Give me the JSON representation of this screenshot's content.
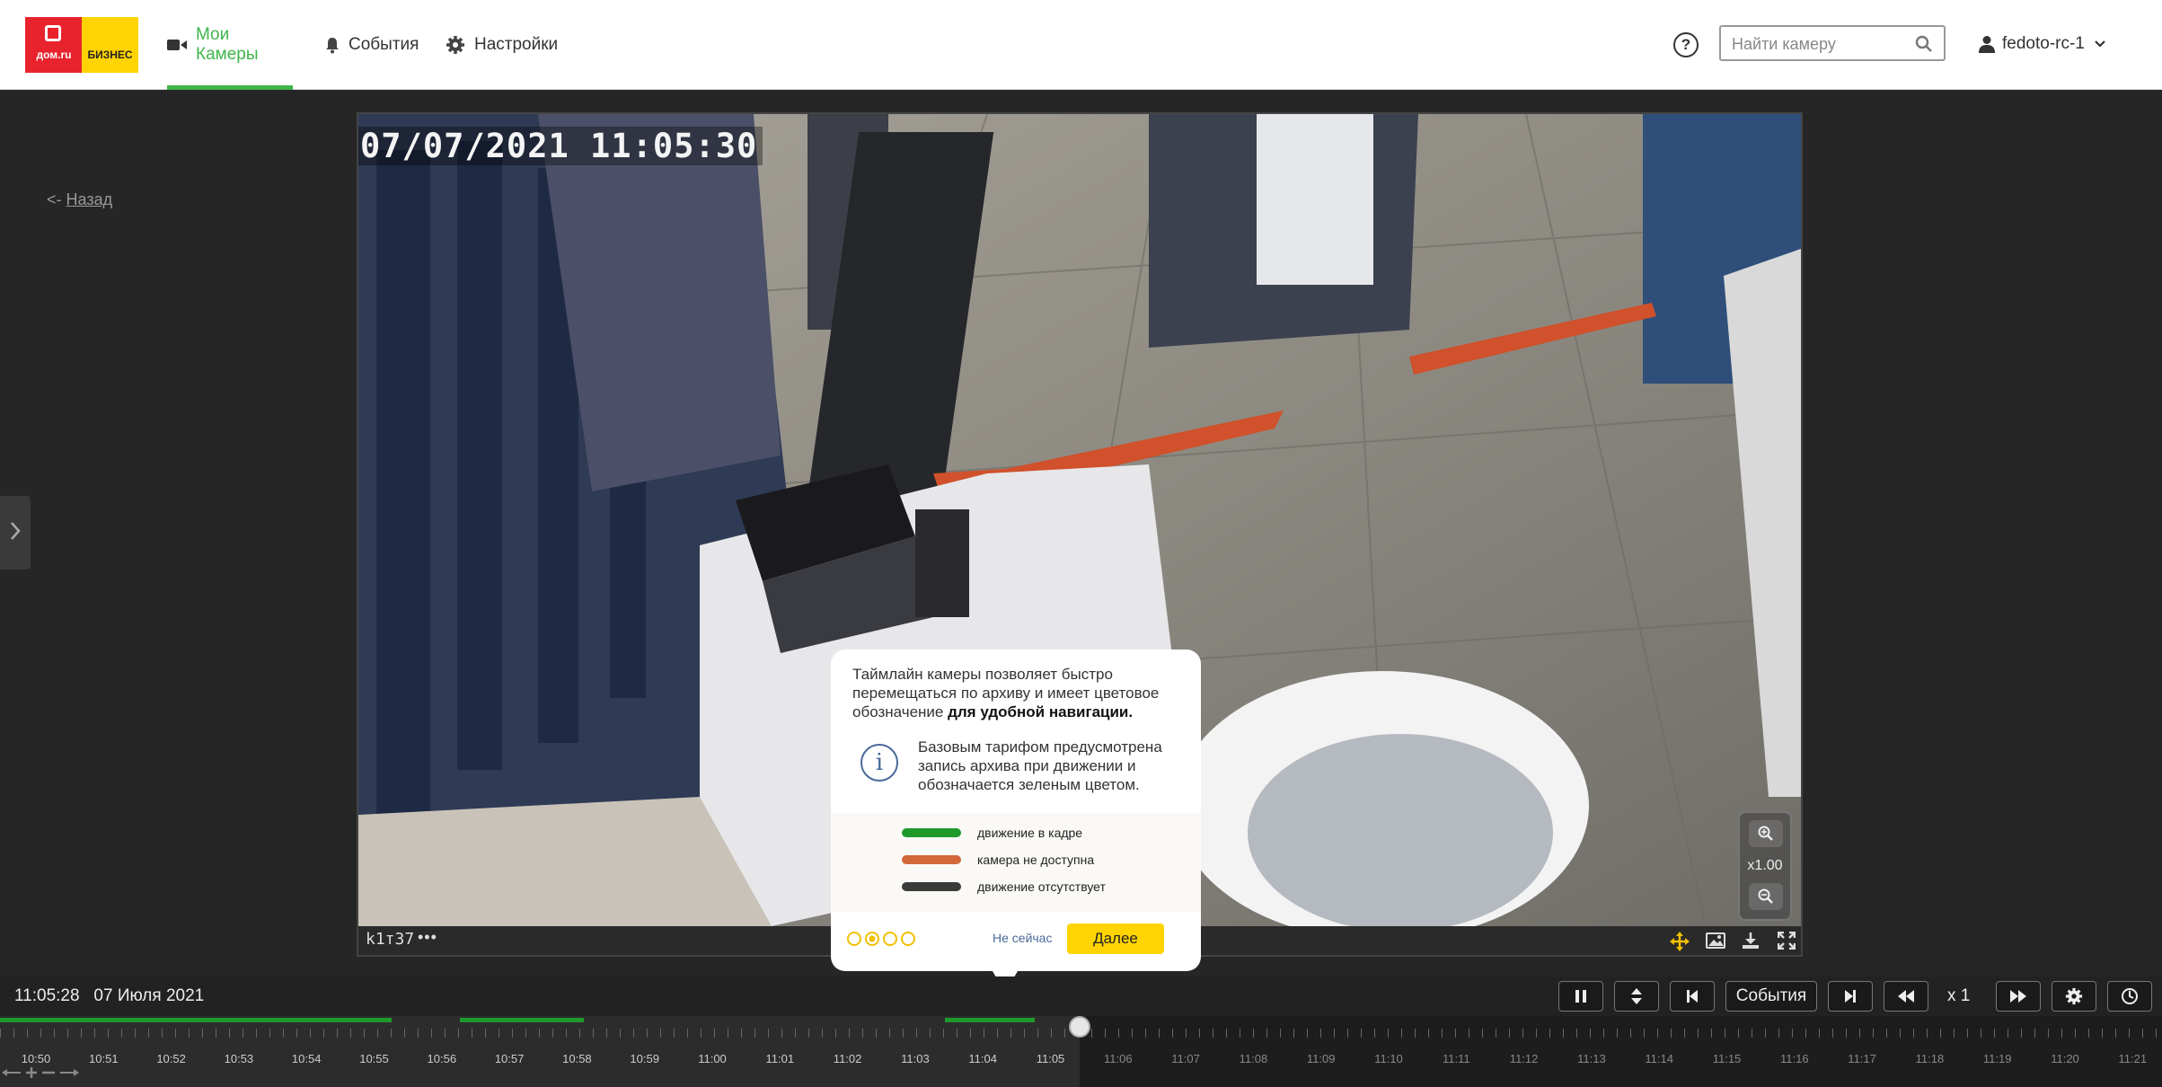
{
  "brand": {
    "logo_left": "дом.ru",
    "logo_right": "бизнес"
  },
  "nav": {
    "cameras": "Мои Камеры",
    "events": "События",
    "settings": "Настройки"
  },
  "header": {
    "help": "?",
    "search_placeholder": "Найти камеру",
    "user": "fedoto-rc-1"
  },
  "back": {
    "arrow": "<-",
    "label": "Назад"
  },
  "video": {
    "timestamp": "07/07/2021 11:05:30",
    "camera_name": "k1т37",
    "menu_dots": "•••",
    "zoom_label": "x1.00"
  },
  "tooltip": {
    "text_main": "Таймлайн камеры позволяет быстро перемещаться по архиву и имеет цветовое обозначение ",
    "text_bold": "для удобной навигации.",
    "info_icon": "i",
    "text_info": "Базовым тарифом предусмотрена запись архива при движении и обозначается зеленым цветом.",
    "legend": [
      {
        "label": "движение в кадре",
        "color": "#1f9a2a"
      },
      {
        "label": "камера не доступна",
        "color": "#d2673a"
      },
      {
        "label": "движение отсутствует",
        "color": "#3a3a3a"
      }
    ],
    "pager": 4,
    "later": "Не сейчас",
    "next": "Далее"
  },
  "controls": {
    "time": "11:05:28",
    "date": "07 Июля 2021",
    "events": "События",
    "speed": "x 1"
  },
  "timeline": {
    "labels": [
      "10:50",
      "10:51",
      "10:52",
      "10:53",
      "10:54",
      "10:55",
      "10:56",
      "10:57",
      "10:58",
      "10:59",
      "11:00",
      "11:01",
      "11:02",
      "11:03",
      "11:04",
      "11:05",
      "11:06",
      "11:07",
      "11:08",
      "11:09",
      "11:10",
      "11:11",
      "11:12",
      "11:13",
      "11:14",
      "11:15",
      "11:16",
      "11:17",
      "11:18",
      "11:19",
      "11:20",
      "11:21"
    ],
    "current_label": "11:05",
    "motion_color": "#1f9a2a"
  }
}
